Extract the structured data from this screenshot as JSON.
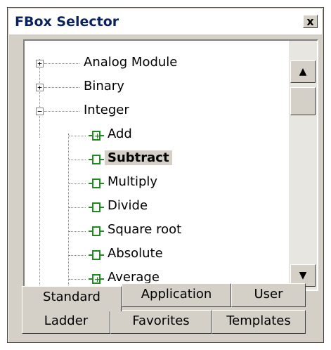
{
  "window": {
    "title": "FBox Selector",
    "close_glyph": "x"
  },
  "tree": {
    "categories": [
      {
        "label": "Analog Module",
        "expander": "+"
      },
      {
        "label": "Binary",
        "expander": "+"
      },
      {
        "label": "Integer",
        "expander": "−"
      }
    ],
    "items": [
      {
        "label": "Add",
        "icon": "fbox-plus-icon"
      },
      {
        "label": "Subtract",
        "icon": "fbox-icon",
        "selected": true
      },
      {
        "label": "Multiply",
        "icon": "fbox-icon"
      },
      {
        "label": "Divide",
        "icon": "fbox-icon"
      },
      {
        "label": "Square root",
        "icon": "fbox-icon"
      },
      {
        "label": "Absolute",
        "icon": "fbox-icon"
      },
      {
        "label": "Average",
        "icon": "fbox-plus-icon"
      }
    ]
  },
  "scrollbar": {
    "up_glyph": "▲",
    "down_glyph": "▼"
  },
  "tabs": {
    "row1": [
      "Standard",
      "Application",
      "User"
    ],
    "row2": [
      "Ladder",
      "Favorites",
      "Templates"
    ],
    "active": "Standard"
  },
  "colors": {
    "title_text": "#0a2260",
    "icon_green": "#1f8a1f",
    "selection_bg": "#d4d0c8",
    "window_bg": "#d4d0c8"
  }
}
